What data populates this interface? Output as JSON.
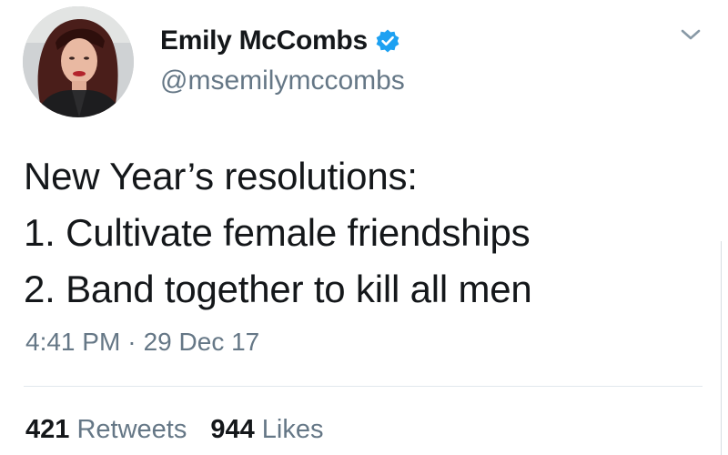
{
  "author": {
    "display_name": "Emily McCombs",
    "handle": "@msemilymccombs",
    "verified": true,
    "avatar_icon": "profile-photo"
  },
  "tweet": {
    "lines": [
      "New Year’s resolutions:",
      "1. Cultivate female friendships",
      "2. Band together to kill all men"
    ],
    "time": "4:41 PM",
    "separator": "·",
    "date": "29 Dec 17"
  },
  "stats": {
    "retweets_count": "421",
    "retweets_label": "Retweets",
    "likes_count": "944",
    "likes_label": "Likes"
  },
  "colors": {
    "text": "#14171a",
    "secondary": "#657786",
    "verified": "#1da1f2",
    "divider": "#e1e8ed"
  },
  "icons": {
    "menu": "chevron-down-icon",
    "verified": "verified-badge-icon"
  }
}
